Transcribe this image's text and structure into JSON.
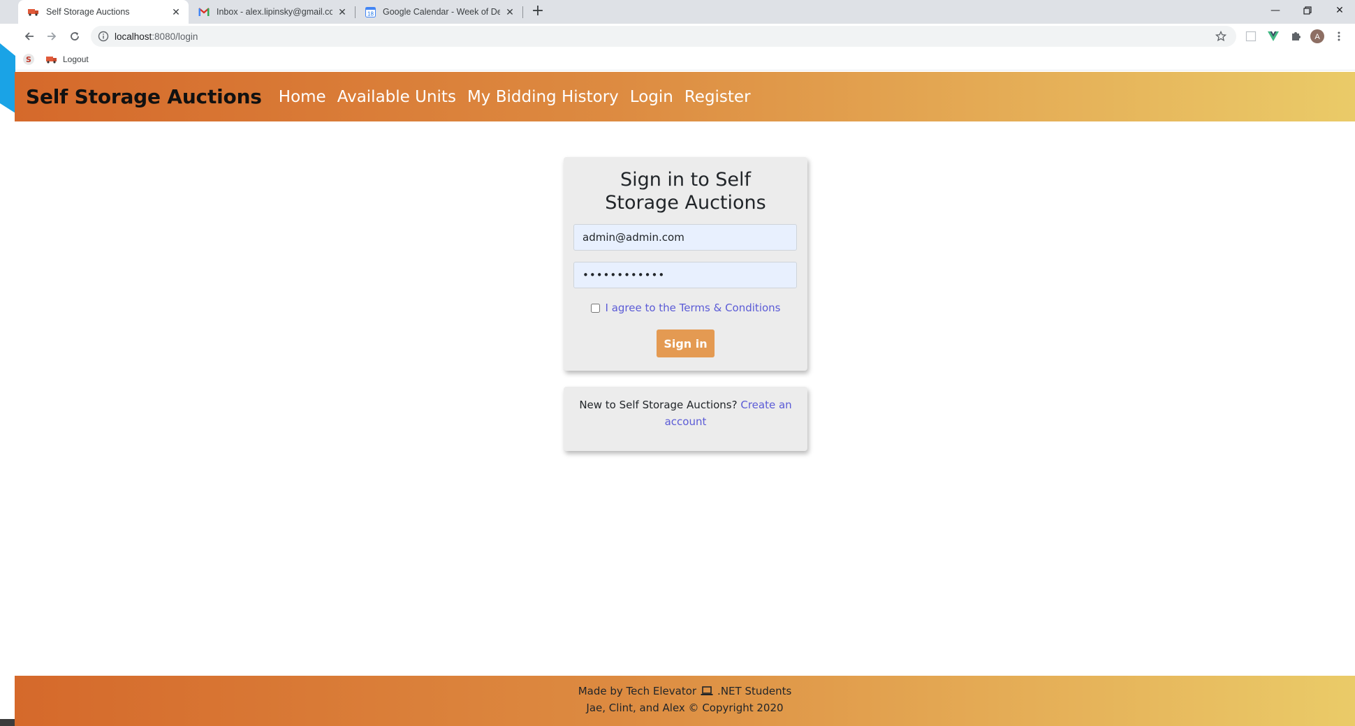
{
  "browser": {
    "tabs": [
      {
        "title": "Self Storage Auctions",
        "icon": "truck-favicon",
        "active": true
      },
      {
        "title": "Inbox - alex.lipinsky@gmail.com",
        "icon": "gmail-favicon",
        "active": false
      },
      {
        "title": "Google Calendar - Week of Dece",
        "icon": "calendar-favicon",
        "active": false
      }
    ],
    "calendar_day": "18",
    "url_host": "localhost",
    "url_path": ":8080/login",
    "profile_initial": "A",
    "bookmarks": [
      {
        "label": "",
        "icon": "s-favicon"
      },
      {
        "label": "Logout",
        "icon": "truck-favicon"
      }
    ]
  },
  "nav": {
    "brand": "Self Storage Auctions",
    "links": [
      "Home",
      "Available Units",
      "My Bidding History",
      "Login",
      "Register"
    ]
  },
  "login": {
    "title": "Sign in to Self Storage Auctions",
    "email_value": "admin@admin.com",
    "password_value": "••••••••••••",
    "agree_label": "I agree to the Terms & Conditions",
    "agree_checked": false,
    "submit_label": "Sign in"
  },
  "register": {
    "prompt": "New to Self Storage Auctions?",
    "link": "Create an account"
  },
  "footer": {
    "line1_before": "Made by Tech Elevator",
    "line1_after": ".NET Students",
    "line2": "Jae, Clint, and Alex © Copyright 2020"
  },
  "colors": {
    "nav_gradient_start": "#d5692b",
    "nav_gradient_end": "#eacb68",
    "button": "#e49a52",
    "link": "#5b5bd6",
    "card": "#ececec",
    "autofill": "#e8f0fe"
  }
}
